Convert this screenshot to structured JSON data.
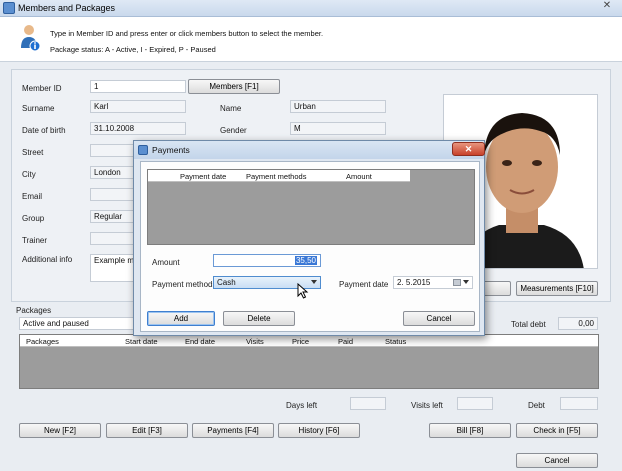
{
  "window": {
    "title": "Members and Packages",
    "close_glyph": "✕"
  },
  "info": {
    "line1": "Type in Member ID and press enter or click members button to select the member.",
    "line2": "Package status: A - Active, I - Expired, P - Paused"
  },
  "form": {
    "member_id_label": "Member ID",
    "member_id_value": "1",
    "members_button": "Members  [F1]",
    "surname_label": "Surname",
    "surname_value": "Karl",
    "name_label": "Name",
    "name_value": "Urban",
    "dob_label": "Date of birth",
    "dob_value": "31.10.2008",
    "gender_label": "Gender",
    "gender_value": "M",
    "street_label": "Street",
    "street_value": "",
    "city_label": "City",
    "city_value": "London",
    "email_label": "Email",
    "email_value": "",
    "group_label": "Group",
    "group_value": "Regular",
    "trainer_label": "Trainer",
    "trainer_value": "",
    "additional_label": "Additional info",
    "additional_value": "Example mem"
  },
  "measurements_button": "Measurements [F10]",
  "packages": {
    "label": "Packages",
    "filter_value": "Active and paused",
    "total_debt_label": "Total debt",
    "total_debt_value": "0,00",
    "columns": [
      "Packages",
      "Start date",
      "End date",
      "Visits",
      "Price",
      "Paid",
      "Status"
    ],
    "days_left_label": "Days left",
    "visits_left_label": "Visits left",
    "debt_label": "Debt"
  },
  "bottom_buttons": {
    "new": "New [F2]",
    "edit": "Edit  [F3]",
    "payments": "Payments [F4]",
    "history": "History [F6]",
    "bill": "Bill [F8]",
    "checkin": "Check in [F5]",
    "cancel": "Cancel"
  },
  "payments_dialog": {
    "title": "Payments",
    "close_glyph": "✕",
    "columns": [
      "Payment date",
      "Payment methods",
      "Amount"
    ],
    "amount_label": "Amount",
    "amount_value": "35,50",
    "methods_label": "Payment methods",
    "methods_value": "Cash",
    "date_label": "Payment date",
    "date_value": "2.  5.2015",
    "add_button": "Add",
    "delete_button": "Delete",
    "cancel_button": "Cancel"
  }
}
